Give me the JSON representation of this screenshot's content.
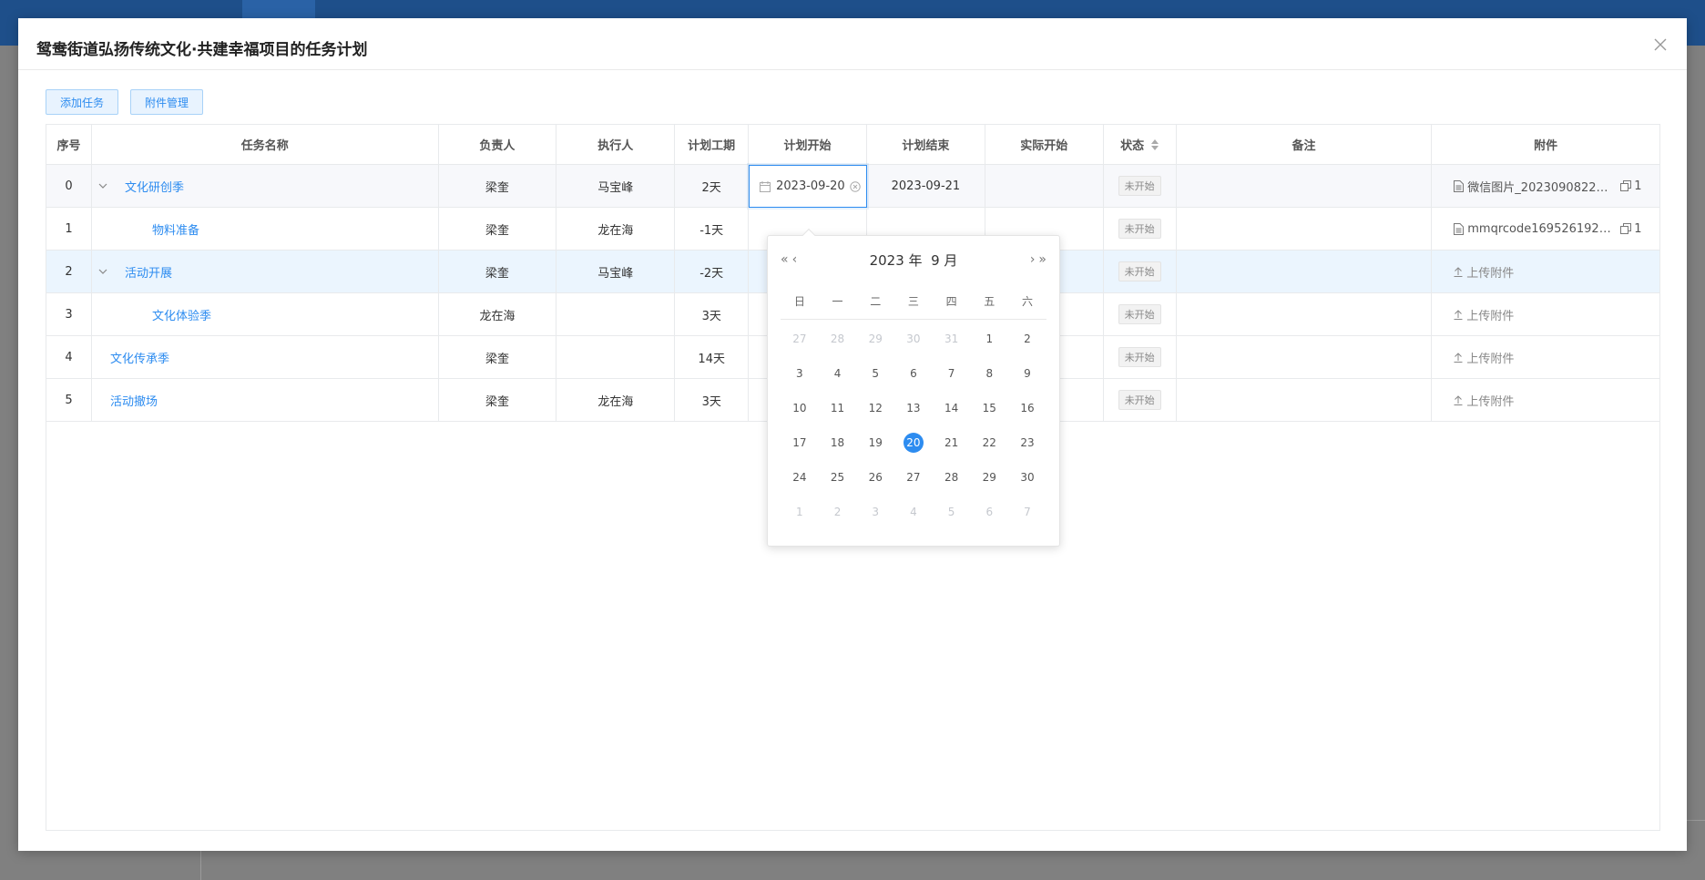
{
  "modal": {
    "title": "鸳鸯街道弘扬传统文化·共建幸福项目的任务计划"
  },
  "toolbar": {
    "add_task": "添加任务",
    "attachments": "附件管理"
  },
  "table": {
    "headers": {
      "index": "序号",
      "name": "任务名称",
      "owner": "负责人",
      "executor": "执行人",
      "duration": "计划工期",
      "plan_start": "计划开始",
      "plan_end": "计划结束",
      "actual_start": "实际开始",
      "status": "状态",
      "remark": "备注",
      "attachment": "附件"
    },
    "rows": [
      {
        "index": "0",
        "name": "文化研创季",
        "owner": "梁奎",
        "executor": "马宝峰",
        "duration": "2天",
        "plan_start": "2023-09-20",
        "plan_end": "2023-09-21",
        "status": "未开始",
        "attachment": "微信图片_20230908224...",
        "attach_count": "1"
      },
      {
        "index": "1",
        "name": "物料准备",
        "owner": "梁奎",
        "executor": "龙在海",
        "duration": "-1天",
        "status": "未开始",
        "attachment": "mmqrcode1695261924...",
        "attach_count": "1"
      },
      {
        "index": "2",
        "name": "活动开展",
        "owner": "梁奎",
        "executor": "马宝峰",
        "duration": "-2天",
        "status": "未开始",
        "upload": "上传附件"
      },
      {
        "index": "3",
        "name": "文化体验季",
        "owner": "龙在海",
        "executor": "",
        "duration": "3天",
        "status": "未开始",
        "upload": "上传附件"
      },
      {
        "index": "4",
        "name": "文化传承季",
        "owner": "梁奎",
        "executor": "",
        "duration": "14天",
        "status": "未开始",
        "upload": "上传附件"
      },
      {
        "index": "5",
        "name": "活动撤场",
        "owner": "梁奎",
        "executor": "龙在海",
        "duration": "3天",
        "status": "未开始",
        "upload": "上传附件"
      }
    ]
  },
  "calendar": {
    "title": "2023 年  9 月",
    "weekdays": [
      "日",
      "一",
      "二",
      "三",
      "四",
      "五",
      "六"
    ],
    "days": [
      {
        "d": "27",
        "o": true
      },
      {
        "d": "28",
        "o": true
      },
      {
        "d": "29",
        "o": true
      },
      {
        "d": "30",
        "o": true
      },
      {
        "d": "31",
        "o": true
      },
      {
        "d": "1"
      },
      {
        "d": "2"
      },
      {
        "d": "3"
      },
      {
        "d": "4"
      },
      {
        "d": "5"
      },
      {
        "d": "6"
      },
      {
        "d": "7"
      },
      {
        "d": "8"
      },
      {
        "d": "9"
      },
      {
        "d": "10"
      },
      {
        "d": "11"
      },
      {
        "d": "12"
      },
      {
        "d": "13"
      },
      {
        "d": "14"
      },
      {
        "d": "15"
      },
      {
        "d": "16"
      },
      {
        "d": "17"
      },
      {
        "d": "18"
      },
      {
        "d": "19"
      },
      {
        "d": "20",
        "s": true
      },
      {
        "d": "21"
      },
      {
        "d": "22"
      },
      {
        "d": "23"
      },
      {
        "d": "24"
      },
      {
        "d": "25"
      },
      {
        "d": "26"
      },
      {
        "d": "27"
      },
      {
        "d": "28"
      },
      {
        "d": "29"
      },
      {
        "d": "30"
      },
      {
        "d": "1",
        "o": true
      },
      {
        "d": "2",
        "o": true
      },
      {
        "d": "3",
        "o": true
      },
      {
        "d": "4",
        "o": true
      },
      {
        "d": "5",
        "o": true
      },
      {
        "d": "6",
        "o": true
      },
      {
        "d": "7",
        "o": true
      }
    ]
  },
  "colors": {
    "accent": "#2d8cf0",
    "topbar": "#1e4f8a"
  }
}
